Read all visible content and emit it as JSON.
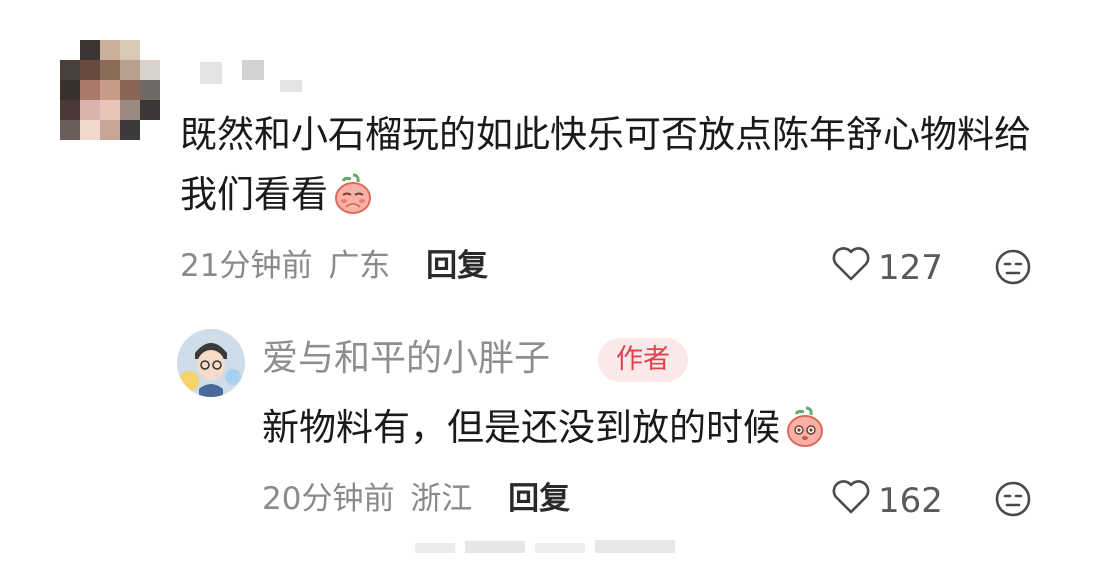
{
  "comment": {
    "text": "既然和小石榴玩的如此快乐可否放点陈年舒心物料给我们看看",
    "time": "21分钟前",
    "location": "广东",
    "reply_label": "回复",
    "likes": "127",
    "emoji": "pleading-peach-emoji"
  },
  "reply": {
    "username": "爱与和平的小胖子",
    "badge": "作者",
    "text": "新物料有，但是还没到放的时候",
    "time": "20分钟前",
    "location": "浙江",
    "reply_label": "回复",
    "likes": "162",
    "emoji": "peach-emoji"
  },
  "colors": {
    "text": "#1a1a1a",
    "meta": "#8a8a8a",
    "badge_bg": "#fbe9ea",
    "badge_text": "#e0424d"
  }
}
